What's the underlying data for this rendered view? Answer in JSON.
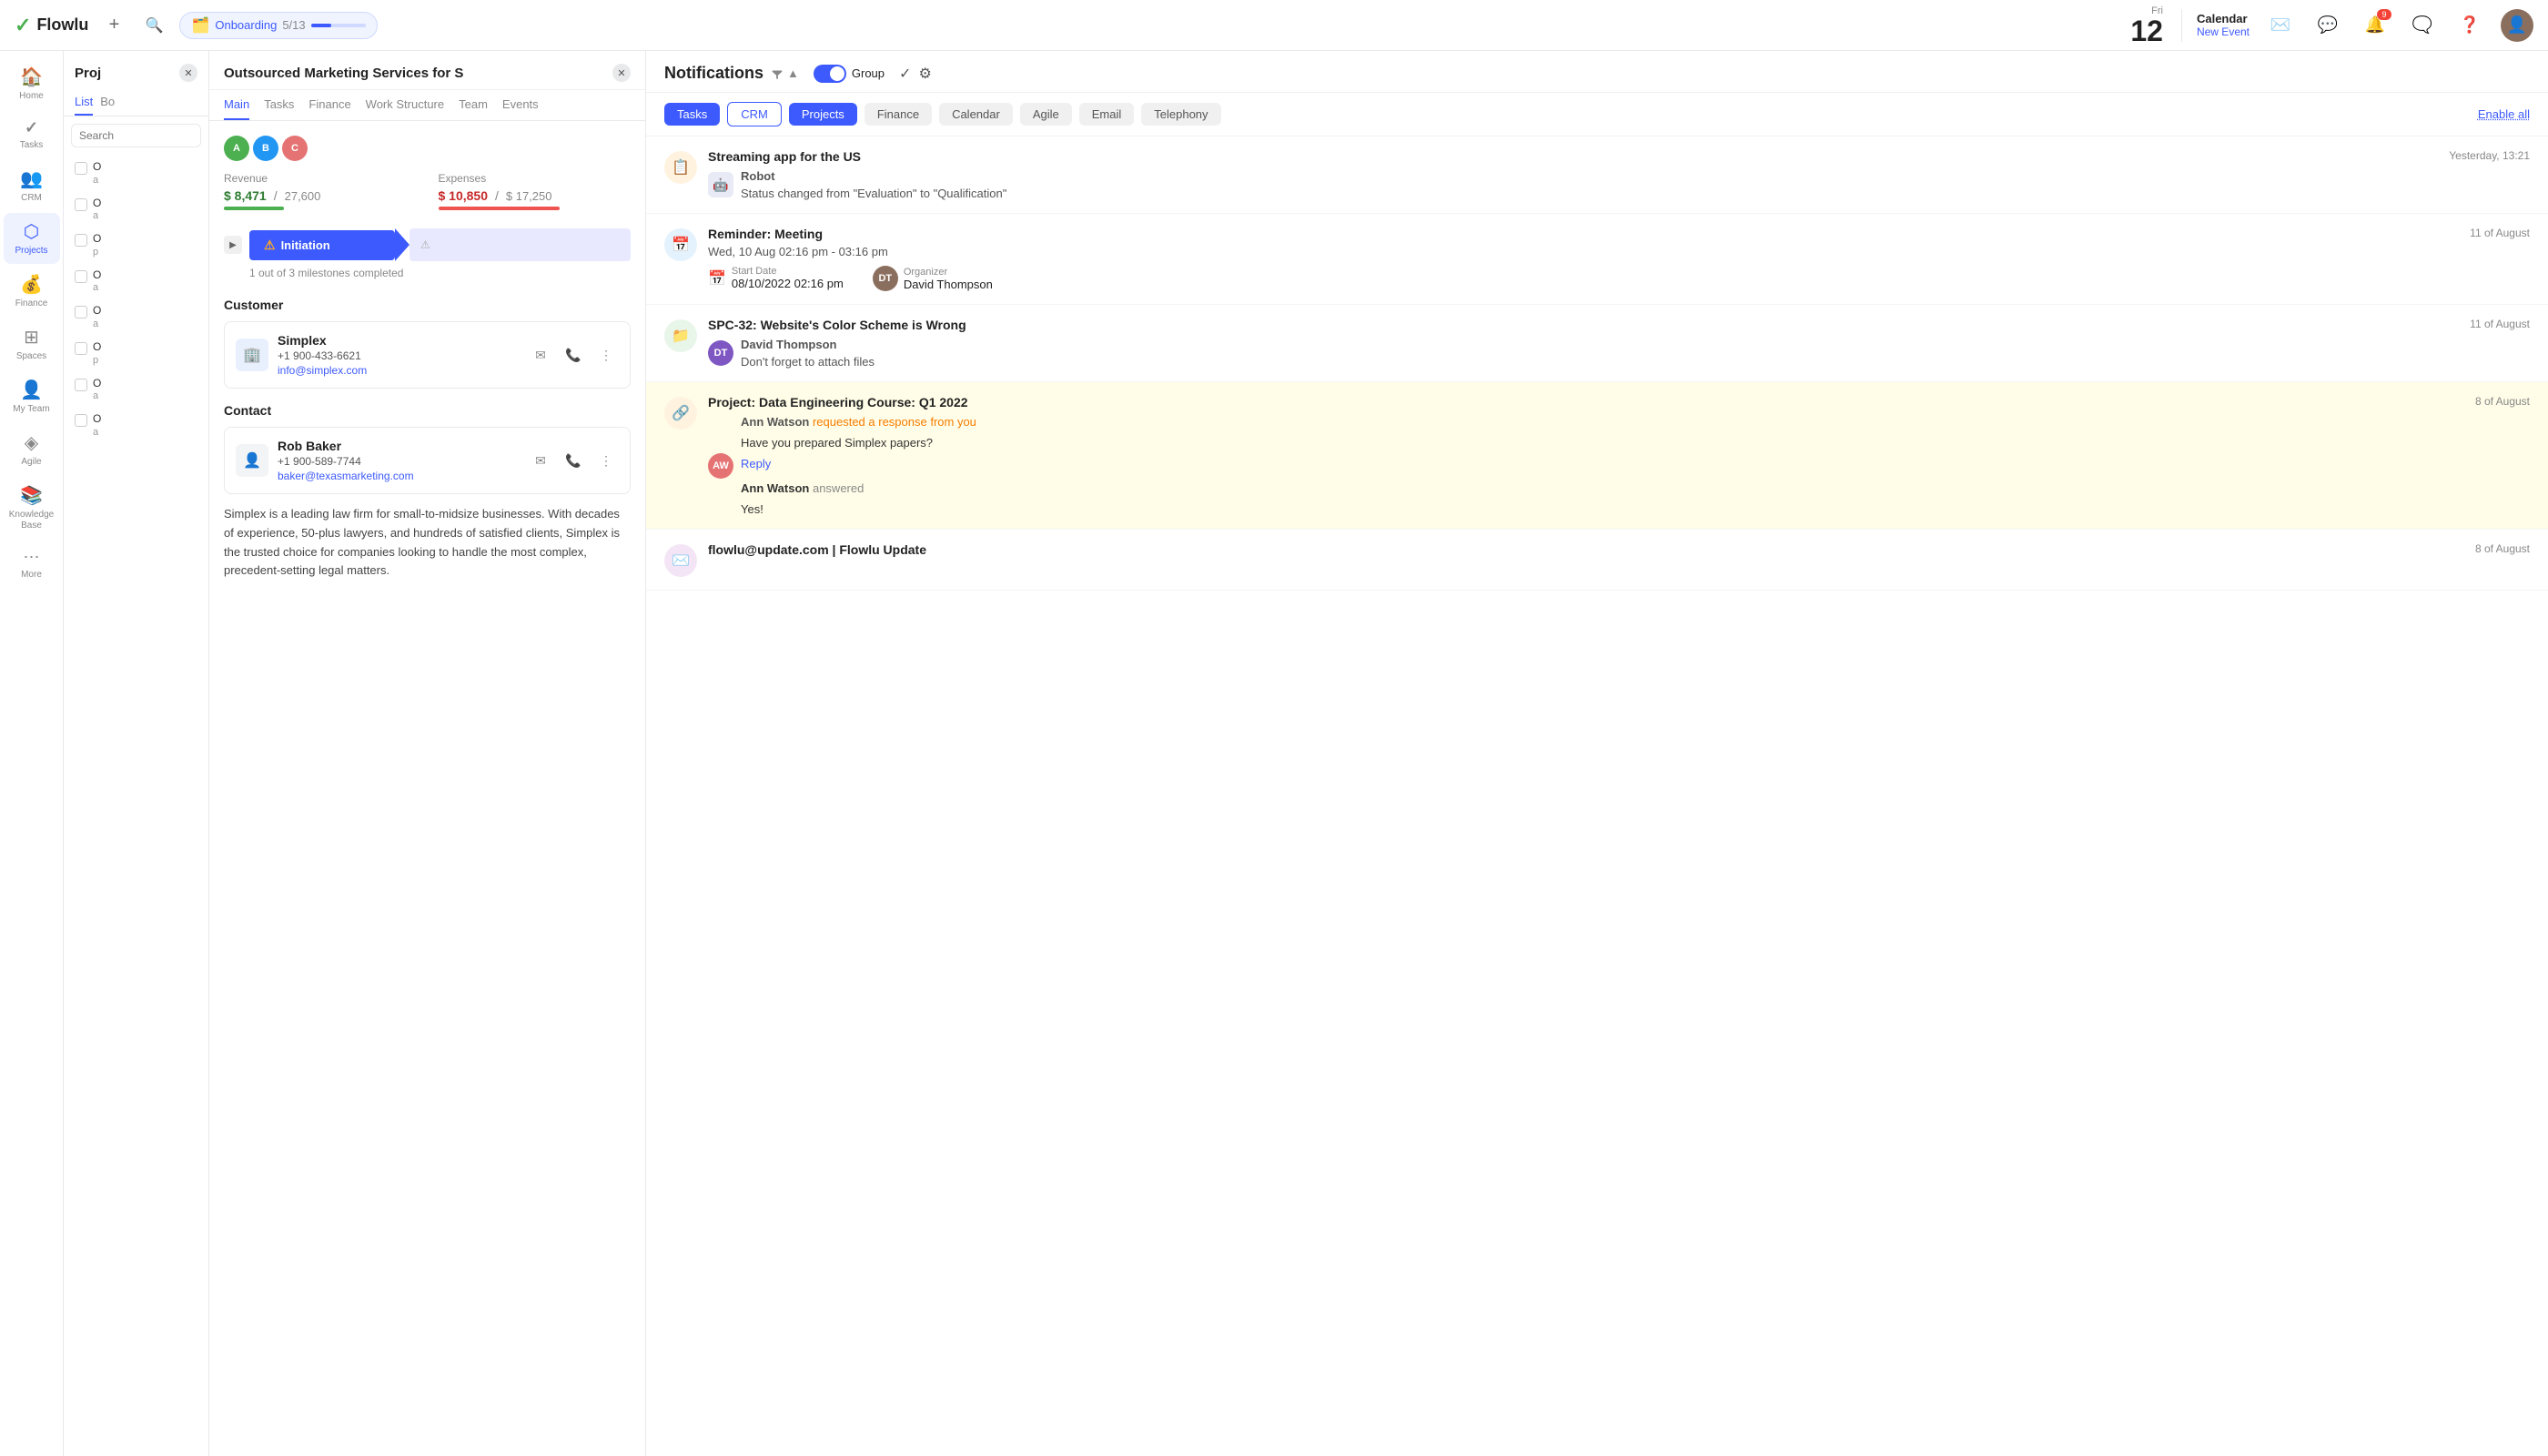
{
  "topbar": {
    "logo_text": "Flowlu",
    "add_label": "+",
    "onboarding_label": "Onboarding",
    "onboarding_progress": "5/13",
    "calendar_day": "Fri",
    "calendar_date": "12",
    "calendar_title": "Calendar",
    "calendar_new_event": "New Event",
    "notification_badge": "9"
  },
  "sidebar": {
    "items": [
      {
        "label": "Home",
        "icon": "🏠",
        "active": false
      },
      {
        "label": "Tasks",
        "icon": "✓",
        "active": false
      },
      {
        "label": "CRM",
        "icon": "👥",
        "active": false
      },
      {
        "label": "Projects",
        "icon": "⬡",
        "active": true
      },
      {
        "label": "Finance",
        "icon": "💰",
        "active": false
      },
      {
        "label": "Spaces",
        "icon": "⊞",
        "active": false
      },
      {
        "label": "My Team",
        "icon": "👤",
        "active": false
      },
      {
        "label": "Agile",
        "icon": "◈",
        "active": false
      },
      {
        "label": "Knowledge Base",
        "icon": "📚",
        "active": false
      },
      {
        "label": "More",
        "icon": "⋯",
        "active": false
      }
    ]
  },
  "projects_panel": {
    "title": "Proj",
    "tabs": [
      "List",
      "Bo"
    ],
    "search_placeholder": "Search",
    "rows": [
      {
        "name": "O",
        "sub": "a"
      },
      {
        "name": "O",
        "sub": "a"
      },
      {
        "name": "O",
        "sub": "p"
      },
      {
        "name": "O",
        "sub": "a"
      },
      {
        "name": "O",
        "sub": "a"
      },
      {
        "name": "O",
        "sub": "p"
      },
      {
        "name": "O",
        "sub": "a"
      },
      {
        "name": "O",
        "sub": "a"
      }
    ]
  },
  "project_detail": {
    "title": "Outsourced Marketing Services for S",
    "tabs": [
      "Main",
      "Tasks",
      "Finance",
      "Work Structure",
      "Team",
      "Events"
    ],
    "revenue": {
      "label": "Revenue",
      "amount": "$ 8,471",
      "total": "27,600",
      "bar_pct": 31
    },
    "expenses": {
      "label": "Expenses",
      "amount": "$ 10,850",
      "total": "$ 17,250",
      "bar_pct": 63
    },
    "milestone": {
      "name": "Initiation",
      "warning_icon": "⚠",
      "sub_text": "1 out of 3 milestones completed"
    },
    "customer": {
      "section_title": "Customer",
      "name": "Simplex",
      "phone": "+1 900-433-6621",
      "email": "info@simplex.com"
    },
    "contact": {
      "section_title": "Contact",
      "name": "Rob Baker",
      "phone": "+1 900-589-7744",
      "email": "baker@texasmarketing.com"
    },
    "description": "Simplex is a leading law firm for small-to-midsize businesses. With decades of experience, 50-plus lawyers, and hundreds of satisfied clients, Simplex is the trusted choice for companies looking to handle the most complex, precedent-setting legal matters."
  },
  "notifications": {
    "title": "Notifications",
    "group_label": "Group",
    "enable_all": "Enable all",
    "tags": [
      {
        "label": "Tasks",
        "style": "blue"
      },
      {
        "label": "CRM",
        "style": "outline"
      },
      {
        "label": "Projects",
        "style": "blue"
      },
      {
        "label": "Finance",
        "style": "gray"
      },
      {
        "label": "Calendar",
        "style": "gray"
      },
      {
        "label": "Agile",
        "style": "gray"
      },
      {
        "label": "Email",
        "style": "gray"
      },
      {
        "label": "Telephony",
        "style": "gray"
      }
    ],
    "items": [
      {
        "type": "crm",
        "title": "Streaming app for the US",
        "time": "Yesterday, 13:21",
        "sender_name": "Robot",
        "sender_icon": "robot",
        "message": "Status changed from \"Evaluation\" to \"Qualification\""
      },
      {
        "type": "calendar",
        "title": "Reminder: Meeting",
        "time": "11 of August",
        "meeting_time": "Wed, 10 Aug 02:16 pm - 03:16 pm",
        "start_label": "Start Date",
        "start_value": "08/10/2022 02:16 pm",
        "organizer_label": "Organizer",
        "organizer_name": "David Thompson",
        "avatar_color": "#8b6f5e"
      },
      {
        "type": "project",
        "title": "SPC-32: Website's Color Scheme is Wrong",
        "time": "11 of August",
        "sender_name": "David Thompson",
        "avatar_color": "#7e57c2",
        "message": "Don't forget to attach files"
      },
      {
        "type": "project",
        "title": "Project: Data Engineering Course: Q1 2022",
        "time": "8 of August",
        "highlighted": true,
        "sender_name": "Ann Watson",
        "avatar_color": "#e57373",
        "requested_text": "requested a response from you",
        "question": "Have you prepared Simplex papers?",
        "reply_label": "Reply",
        "answered_by": "Ann Watson",
        "answered_text": "answered",
        "answer": "Yes!"
      },
      {
        "type": "email",
        "title": "flowlu@update.com | Flowlu Update",
        "time": "8 of August"
      }
    ]
  }
}
